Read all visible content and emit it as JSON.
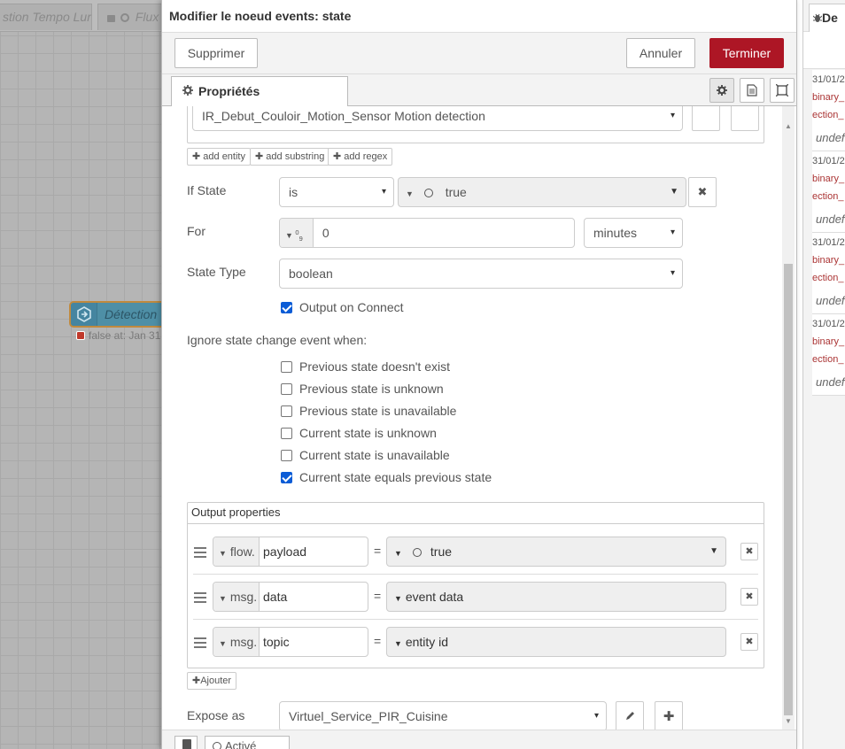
{
  "workspace": {
    "tab1_label": "stion Tempo Lur",
    "tab2_label": "Flux",
    "node_label": "Détection",
    "node_status": "false at: Jan 31"
  },
  "editor": {
    "title": "Modifier le noeud events: state",
    "delete_label": "Supprimer",
    "cancel_label": "Annuler",
    "done_label": "Terminer",
    "properties_tab": "Propriétés",
    "entity_value": "IR_Debut_Couloir_Motion_Sensor Motion detection",
    "add_entity": "add entity",
    "add_substring": "add substring",
    "add_regex": "add regex",
    "if_state": {
      "label": "If State",
      "operator": "is",
      "value": "true"
    },
    "for": {
      "label": "For",
      "value": "0",
      "unit": "minutes"
    },
    "state_type": {
      "label": "State Type",
      "value": "boolean"
    },
    "output_on_connect": {
      "label": "Output on Connect",
      "checked": true
    },
    "ignore_heading": "Ignore state change event when:",
    "ignore_options": [
      {
        "label": "Previous state doesn't exist",
        "checked": false
      },
      {
        "label": "Previous state is unknown",
        "checked": false
      },
      {
        "label": "Previous state is unavailable",
        "checked": false
      },
      {
        "label": "Current state is unknown",
        "checked": false
      },
      {
        "label": "Current state is unavailable",
        "checked": false
      },
      {
        "label": "Current state equals previous state",
        "checked": true
      }
    ],
    "output_properties": {
      "heading": "Output properties",
      "rows": [
        {
          "prefix": "flow.",
          "key": "payload",
          "value": "true"
        },
        {
          "prefix": "msg.",
          "key": "data",
          "value": "event data"
        },
        {
          "prefix": "msg.",
          "key": "topic",
          "value": "entity id"
        }
      ]
    },
    "add_label": "Ajouter",
    "expose_as": {
      "label": "Expose as",
      "value": "Virtuel_Service_PIR_Cuisine"
    },
    "enabled_label": "Activé"
  },
  "sidebar": {
    "tab_label": "De",
    "messages": [
      {
        "date": "31/01/2",
        "topic1": "binary_",
        "topic2": "ection_",
        "payload": "undef"
      },
      {
        "date": "31/01/2",
        "topic1": "binary_",
        "topic2": "ection_",
        "payload": "undef"
      },
      {
        "date": "31/01/2",
        "topic1": "binary_",
        "topic2": "ection_",
        "payload": "undef"
      },
      {
        "date": "31/01/2",
        "topic1": "binary_",
        "topic2": "ection_",
        "payload": "undef"
      }
    ]
  },
  "colors": {
    "accent": "#ad1625",
    "node": "#4e8fa6",
    "checkbox": "#0b5cd6"
  }
}
